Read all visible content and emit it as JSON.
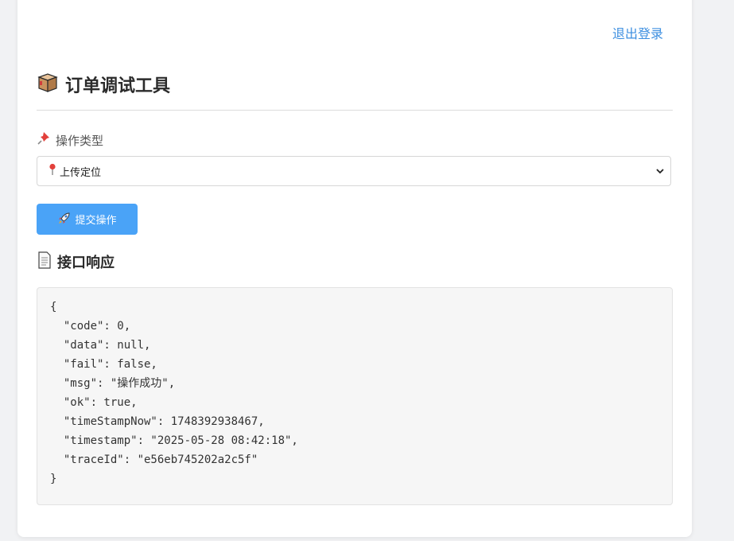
{
  "header": {
    "logout_label": "退出登录"
  },
  "page": {
    "title": "订单调试工具",
    "title_icon": "package-box-icon"
  },
  "form": {
    "operation_label": "操作类型",
    "operation_label_icon": "pushpin-icon",
    "operation_select": {
      "selected": "上传定位",
      "selected_icon": "round-pin-icon"
    },
    "submit_label": "提交操作",
    "submit_icon": "rocket-icon"
  },
  "response": {
    "title": "接口响应",
    "title_icon": "document-icon",
    "lines": [
      "{",
      "  \"code\": 0,",
      "  \"data\": null,",
      "  \"fail\": false,",
      "  \"msg\": \"操作成功\",",
      "  \"ok\": true,",
      "  \"timeStampNow\": 1748392938467,",
      "  \"timestamp\": \"2025-05-28 08:42:18\",",
      "  \"traceId\": \"e56eb745202a2c5f\"",
      "}"
    ]
  },
  "colors": {
    "link": "#3d8fe0",
    "primary_button": "#4aa3f7",
    "code_background": "#f6f6f6"
  }
}
